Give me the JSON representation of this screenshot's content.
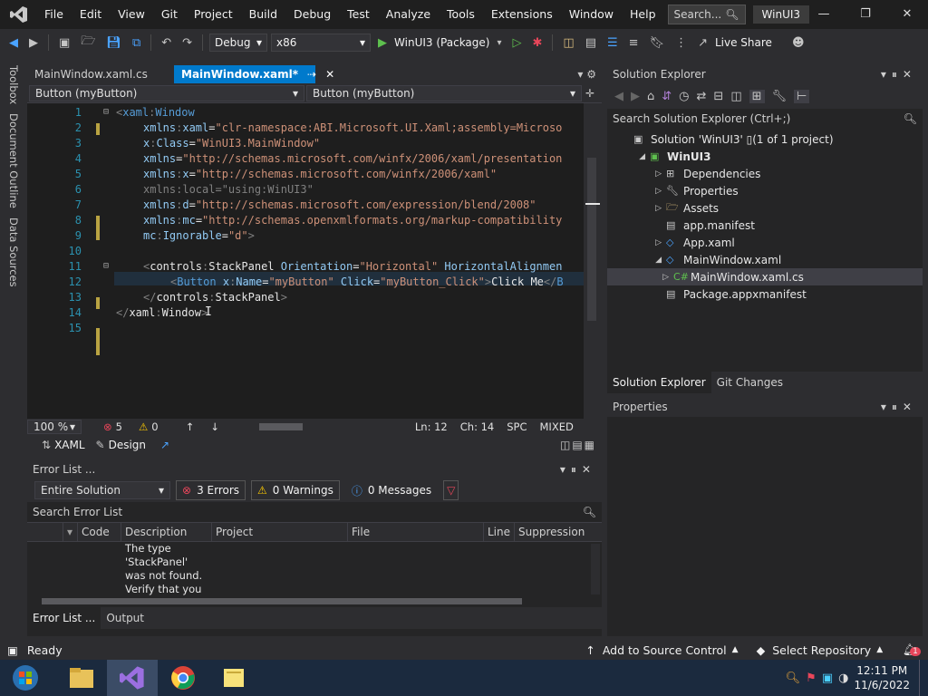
{
  "titlebar": {
    "menu": [
      "File",
      "Edit",
      "View",
      "Git",
      "Project",
      "Build",
      "Debug",
      "Test",
      "Analyze",
      "Tools",
      "Extensions",
      "Window",
      "Help"
    ],
    "search_placeholder": "Search...",
    "solution_name": "WinUI3",
    "controls": {
      "minimize": "—",
      "restore": "❐",
      "close": "✕"
    }
  },
  "toolbar": {
    "config": "Debug",
    "platform": "x86",
    "run_target": "WinUI3 (Package)",
    "live_share": "Live Share"
  },
  "siderail": {
    "items": [
      "Toolbox",
      "Document Outline",
      "Data Sources"
    ]
  },
  "editor": {
    "tabs": [
      {
        "label": "MainWindow.xaml.cs",
        "active": false
      },
      {
        "label": "MainWindow.xaml*",
        "active": true
      }
    ],
    "nav_left": "Button (myButton)",
    "nav_right": "Button (myButton)",
    "lines": [
      {
        "n": "1",
        "parts": [
          [
            "p",
            "<"
          ],
          [
            "t",
            "xaml"
          ],
          [
            "p",
            ":"
          ],
          [
            "t",
            "Window"
          ]
        ]
      },
      {
        "n": "2",
        "parts": [
          [
            "a",
            "xmlns"
          ],
          [
            "p",
            ":"
          ],
          [
            "a",
            "xaml"
          ],
          [
            "w",
            "="
          ],
          [
            "v",
            "\"clr-namespace:ABI.Microsoft.UI.Xaml;assembly=Microso"
          ]
        ]
      },
      {
        "n": "3",
        "parts": [
          [
            "a",
            "x"
          ],
          [
            "p",
            ":"
          ],
          [
            "a",
            "Class"
          ],
          [
            "w",
            "="
          ],
          [
            "v",
            "\"WinUI3.MainWindow\""
          ]
        ]
      },
      {
        "n": "4",
        "parts": [
          [
            "a",
            "xmlns"
          ],
          [
            "w",
            "="
          ],
          [
            "v",
            "\"http://schemas.microsoft.com/winfx/2006/xaml/presentation"
          ]
        ]
      },
      {
        "n": "5",
        "parts": [
          [
            "a",
            "xmlns"
          ],
          [
            "p",
            ":"
          ],
          [
            "a",
            "x"
          ],
          [
            "w",
            "="
          ],
          [
            "v",
            "\"http://schemas.microsoft.com/winfx/2006/xaml\""
          ]
        ]
      },
      {
        "n": "6",
        "parts": [
          [
            "p",
            "xmlns:local=\"using:WinUI3\""
          ]
        ]
      },
      {
        "n": "7",
        "parts": [
          [
            "a",
            "xmlns"
          ],
          [
            "p",
            ":"
          ],
          [
            "a",
            "d"
          ],
          [
            "w",
            "="
          ],
          [
            "v",
            "\"http://schemas.microsoft.com/expression/blend/2008\""
          ]
        ]
      },
      {
        "n": "8",
        "parts": [
          [
            "a",
            "xmlns"
          ],
          [
            "p",
            ":"
          ],
          [
            "a",
            "mc"
          ],
          [
            "w",
            "="
          ],
          [
            "v",
            "\"http://schemas.openxmlformats.org/markup-compatibility"
          ]
        ]
      },
      {
        "n": "9",
        "parts": [
          [
            "a",
            "mc"
          ],
          [
            "p",
            ":"
          ],
          [
            "a",
            "Ignorable"
          ],
          [
            "w",
            "="
          ],
          [
            "v",
            "\"d\""
          ],
          [
            "p",
            ">"
          ]
        ]
      },
      {
        "n": "10",
        "parts": []
      },
      {
        "n": "11",
        "parts": [
          [
            "p",
            "<"
          ],
          [
            "w",
            "controls"
          ],
          [
            "p",
            ":"
          ],
          [
            "w",
            "StackPanel"
          ],
          [
            "w",
            " "
          ],
          [
            "a",
            "Orientation"
          ],
          [
            "w",
            "="
          ],
          [
            "v",
            "\"Horizontal\""
          ],
          [
            "w",
            " "
          ],
          [
            "a",
            "HorizontalAlignmen"
          ]
        ]
      },
      {
        "n": "12",
        "parts": [
          [
            "p",
            "<"
          ],
          [
            "t",
            "Button"
          ],
          [
            "w",
            " "
          ],
          [
            "a",
            "x"
          ],
          [
            "p",
            ":"
          ],
          [
            "a",
            "Name"
          ],
          [
            "w",
            "="
          ],
          [
            "v",
            "\"myButton\""
          ],
          [
            "w",
            " "
          ],
          [
            "a",
            "Click"
          ],
          [
            "w",
            "="
          ],
          [
            "v",
            "\"myButton_Click\""
          ],
          [
            "p",
            ">"
          ],
          [
            "w",
            "Click Me"
          ],
          [
            "p",
            "</"
          ],
          [
            "t",
            "B"
          ]
        ]
      },
      {
        "n": "13",
        "parts": [
          [
            "p",
            "</"
          ],
          [
            "w",
            "controls"
          ],
          [
            "p",
            ":"
          ],
          [
            "w",
            "StackPanel"
          ],
          [
            "p",
            ">"
          ]
        ]
      },
      {
        "n": "14",
        "parts": [
          [
            "p",
            "</"
          ],
          [
            "w",
            "xaml"
          ],
          [
            "p",
            ":"
          ],
          [
            "w",
            "Window"
          ],
          [
            "p",
            ">"
          ]
        ]
      },
      {
        "n": "15",
        "parts": []
      }
    ],
    "zoom": "100 %",
    "errors_count": "5",
    "warnings_count": "0",
    "ln": "Ln: 12",
    "ch": "Ch: 14",
    "spc": "SPC",
    "mixed": "MIXED",
    "view_tabs": [
      "XAML",
      "Design"
    ]
  },
  "errorlist": {
    "title": "Error List ...",
    "scope": "Entire Solution",
    "errors_btn": "3 Errors",
    "warnings_btn": "0 Warnings",
    "messages_btn": "0 Messages",
    "search_placeholder": "Search Error List",
    "columns": [
      "Code",
      "Description",
      "Project",
      "File",
      "Line",
      "Suppression S"
    ],
    "rows": [
      {
        "code": "",
        "description": "The type 'StackPanel' was not found. Verify that you are not",
        "project": "",
        "file": "",
        "line": ""
      }
    ],
    "bottom_tabs": [
      "Error List ...",
      "Output"
    ]
  },
  "solution_explorer": {
    "title": "Solution Explorer",
    "search_placeholder": "Search Solution Explorer (Ctrl+;)",
    "nodes": [
      {
        "label": "Solution 'WinUI3' ▯(1 of 1 project)",
        "indent": 0,
        "icon": "solution-icon",
        "arrow": ""
      },
      {
        "label": "WinUI3",
        "indent": 1,
        "icon": "csharp-project-icon",
        "arrow": "◢",
        "bold": true
      },
      {
        "label": "Dependencies",
        "indent": 2,
        "icon": "dependencies-icon",
        "arrow": "▷"
      },
      {
        "label": "Properties",
        "indent": 2,
        "icon": "wrench-icon",
        "arrow": "▷"
      },
      {
        "label": "Assets",
        "indent": 2,
        "icon": "folder-icon",
        "arrow": "▷"
      },
      {
        "label": "app.manifest",
        "indent": 2,
        "icon": "manifest-icon",
        "arrow": ""
      },
      {
        "label": "App.xaml",
        "indent": 2,
        "icon": "xaml-icon",
        "arrow": "▷"
      },
      {
        "label": "MainWindow.xaml",
        "indent": 2,
        "icon": "xaml-icon",
        "arrow": "◢"
      },
      {
        "label": "MainWindow.xaml.cs",
        "indent": 3,
        "icon": "csharp-file-icon",
        "arrow": "▷",
        "selected": true
      },
      {
        "label": "Package.appxmanifest",
        "indent": 2,
        "icon": "package-icon",
        "arrow": ""
      }
    ],
    "tabs": [
      "Solution Explorer",
      "Git Changes"
    ]
  },
  "properties": {
    "title": "Properties"
  },
  "statusbar": {
    "ready": "Ready",
    "source_control": "Add to Source Control",
    "repository": "Select Repository",
    "notifications": "1"
  },
  "taskbar": {
    "time": "12:11 PM",
    "date": "11/6/2022"
  }
}
